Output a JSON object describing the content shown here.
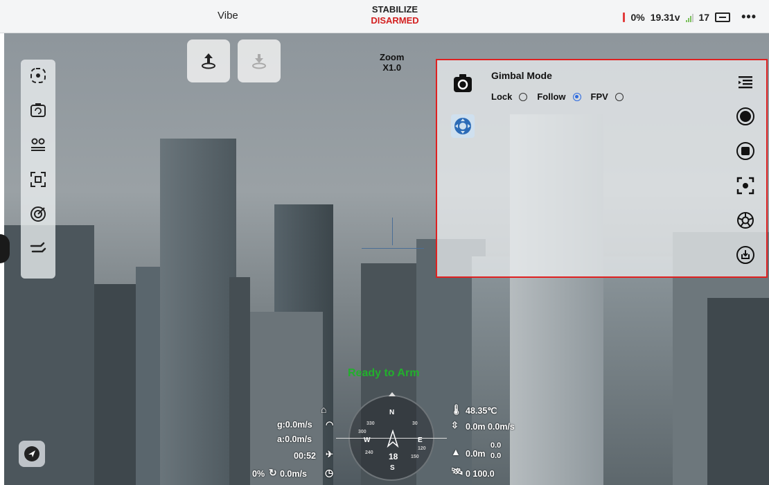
{
  "topbar": {
    "app_name": "Vibe",
    "flight_mode": "STABILIZE",
    "arm_state": "DISARMED",
    "battery_percent": "0%",
    "voltage": "19.31v",
    "satellites": "17",
    "arm_state_color": "#d31f1f"
  },
  "zoom": {
    "label": "Zoom",
    "value": "X1.0"
  },
  "gimbal_panel": {
    "title": "Gimbal Mode",
    "options": [
      {
        "label": "Lock",
        "selected": false
      },
      {
        "label": "Follow",
        "selected": true
      },
      {
        "label": "FPV",
        "selected": false
      }
    ]
  },
  "video": {
    "status_text": "Ready to Arm",
    "status_color": "#22b02c"
  },
  "telemetry_left": {
    "ground_speed": "g:0.0m/s",
    "air_speed": "a:0.0m/s",
    "flight_time": "00:52",
    "throttle": "0%",
    "vertical_speed": "0.0m/s"
  },
  "telemetry_right": {
    "temperature": "48.35℃",
    "height_speed": "0.0m 0.0m/s",
    "altitude": "0.0m",
    "alt_sub_top": "0.0",
    "alt_sub_bottom": "0.0",
    "gps": "0 100.0"
  },
  "compass": {
    "north": "N",
    "south": "S",
    "east": "E",
    "west": "W",
    "tick_330": "330",
    "tick_30": "30",
    "tick_300": "300",
    "tick_120": "120",
    "tick_240": "240",
    "tick_150": "150",
    "heading": "18"
  }
}
